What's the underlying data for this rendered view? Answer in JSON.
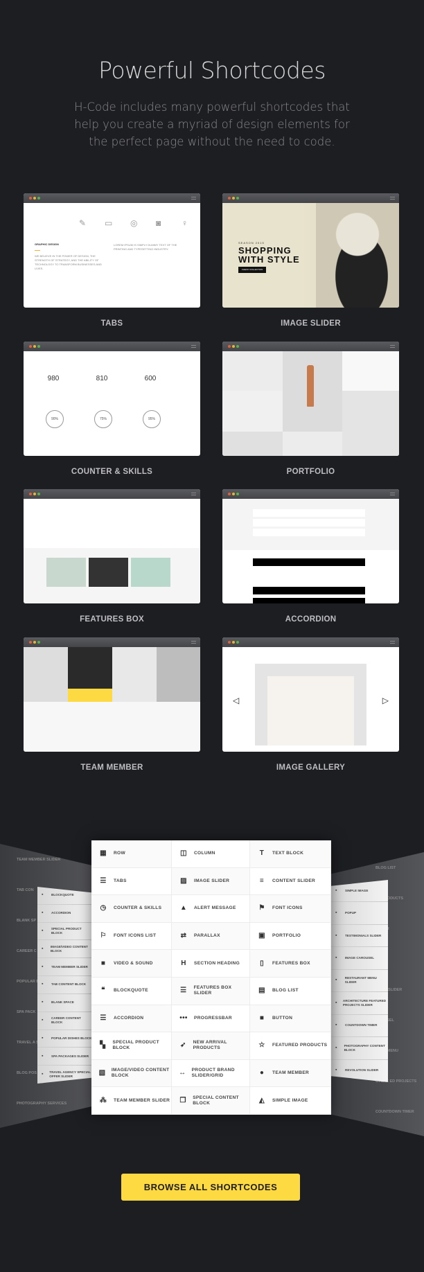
{
  "header": {
    "title": "Powerful Shortcodes",
    "subtitle": "H-Code includes many powerful shortcodes that help you create a myriad of design elements for the perfect page without the need to code."
  },
  "window_dots": [
    "#e2613a",
    "#e5b631",
    "#5ab04a"
  ],
  "cards": [
    {
      "label": "TABS",
      "heading": "GRAPHIC DESIGN",
      "text": "WE BELIEVE IN THE POWER OF DESIGN, THE STRENGTH OF STRATEGY, AND THE ABILITY OF TECHNOLOGY TO TRANSFORM BUSINESSES AND LIVES.",
      "side": "LOREM IPSUM IS SIMPLY DUMMY TEXT OF THE PRINTING AND TYPESETTING INDUSTRY."
    },
    {
      "label": "IMAGE SLIDER",
      "season": "SEASON 2015",
      "headline": "SHOPPING WITH STYLE",
      "cta": "CHECK COLLECTION"
    },
    {
      "label": "COUNTER & SKILLS",
      "counters": [
        "980",
        "810",
        "600"
      ],
      "skills": [
        "90%",
        "75%",
        "95%"
      ]
    },
    {
      "label": "PORTFOLIO"
    },
    {
      "label": "FEATURES BOX"
    },
    {
      "label": "ACCORDION"
    },
    {
      "label": "TEAM MEMBER"
    },
    {
      "label": "IMAGE GALLERY"
    }
  ],
  "shortcodes": [
    {
      "label": "ROW",
      "icon": "grid-icon",
      "glyph": "▦"
    },
    {
      "label": "COLUMN",
      "icon": "column-icon",
      "glyph": "◫"
    },
    {
      "label": "TEXT BLOCK",
      "icon": "text-icon",
      "glyph": "T"
    },
    {
      "label": "TABS",
      "icon": "tabs-icon",
      "glyph": "☰"
    },
    {
      "label": "IMAGE SLIDER",
      "icon": "image-icon",
      "glyph": "▨"
    },
    {
      "label": "CONTENT SLIDER",
      "icon": "content-slider-icon",
      "glyph": "≡"
    },
    {
      "label": "COUNTER & SKILLS",
      "icon": "clock-icon",
      "glyph": "◷"
    },
    {
      "label": "ALERT MESSAGE",
      "icon": "warning-icon",
      "glyph": "▲"
    },
    {
      "label": "FONT ICONS",
      "icon": "flag-icon",
      "glyph": "⚑"
    },
    {
      "label": "FONT ICONS LIST",
      "icon": "flag-outline-icon",
      "glyph": "⚐"
    },
    {
      "label": "PARALLAX",
      "icon": "arrows-exchange-icon",
      "glyph": "⇄"
    },
    {
      "label": "PORTFOLIO",
      "icon": "briefcase-icon",
      "glyph": "▣"
    },
    {
      "label": "VIDEO & SOUND",
      "icon": "video-camera-icon",
      "glyph": "■"
    },
    {
      "label": "SECTION HEADING",
      "icon": "heading-icon",
      "glyph": "H"
    },
    {
      "label": "FEATURES BOX",
      "icon": "tablet-icon",
      "glyph": "▯"
    },
    {
      "label": "BLOCKQUOTE",
      "icon": "quote-icon",
      "glyph": "❝"
    },
    {
      "label": "FEATURES BOX SLIDER",
      "icon": "list-icon",
      "glyph": "☰"
    },
    {
      "label": "BLOG LIST",
      "icon": "blog-icon",
      "glyph": "▤"
    },
    {
      "label": "ACCORDION",
      "icon": "accordion-icon",
      "glyph": "☰"
    },
    {
      "label": "PROGRESSBAR",
      "icon": "dots-icon",
      "glyph": "•••"
    },
    {
      "label": "BUTTON",
      "icon": "square-icon",
      "glyph": "■"
    },
    {
      "label": "SPECIAL PRODUCT BLOCK",
      "icon": "blocks-icon",
      "glyph": "▚"
    },
    {
      "label": "NEW ARRIVAL PRODUCTS",
      "icon": "rocket-icon",
      "glyph": "➶"
    },
    {
      "label": "FEATURED PRODUCTS",
      "icon": "star-icon",
      "glyph": "☆"
    },
    {
      "label": "IMAGE/VIDEO CONTENT BLOCK",
      "icon": "file-video-icon",
      "glyph": "▧"
    },
    {
      "label": "PRODUCT BRAND SLIDER/GRID",
      "icon": "arrows-horizontal-icon",
      "glyph": "↔"
    },
    {
      "label": "TEAM MEMBER",
      "icon": "user-icon",
      "glyph": "●"
    },
    {
      "label": "TEAM MEMBER SLIDER",
      "icon": "users-icon",
      "glyph": "⁂"
    },
    {
      "label": "SPECIAL CONTENT BLOCK",
      "icon": "copy-icon",
      "glyph": "❐"
    },
    {
      "label": "SIMPLE IMAGE",
      "icon": "area-chart-icon",
      "glyph": "◭"
    }
  ],
  "left_panel": [
    "BLOCKQUOTE",
    "ACCORDION",
    "SPECIAL PRODUCT BLOCK",
    "IMAGE/VIDEO CONTENT BLOCK",
    "TEAM MEMBER SLIDER",
    "TAB CONTENT BLOCK",
    "BLANK SPACE",
    "CAREER CONTENT BLOCK",
    "POPULAR DISHES BLOCK",
    "SPA PACKAGES SLIDER",
    "TRAVEL AGENCY SPECIAL OFFER SLIDER"
  ],
  "left_back": [
    "TEAM MEMBER SLIDER",
    "TAB CON",
    "BLANK SP",
    "CAREER C BLOCK",
    "POPULAR BLOCK",
    "SPA PACK",
    "TRAVEL A SPECIAL O",
    "BLOG POS",
    "PHOTOGRAPHY SERVICES"
  ],
  "right_panel": [
    "SIMPLE IMAGE",
    "POPUP",
    "TESTIMONIALS SLIDER",
    "IMAGE CAROUSEL",
    "RESTAURANT MENU SLIDER",
    "ARCHITECTURE FEATURED PROJECTS SLIDER",
    "COUNTDOWN TIMER",
    "PHOTOGRAPHY CONTENT BLOCK",
    "REVOLUTION SLIDER"
  ],
  "right_back": [
    "BLOG LIST",
    "ED PRODUCTS",
    "EMBER",
    "IMAGE",
    "NIALS SLIDER",
    "AROUSEL",
    "RANT MENU",
    "CTURE ED PROJECTS",
    "COUNTDOWN TIMER"
  ],
  "cta": {
    "label": "BROWSE ALL SHORTCODES",
    "color": "#fdd942"
  }
}
